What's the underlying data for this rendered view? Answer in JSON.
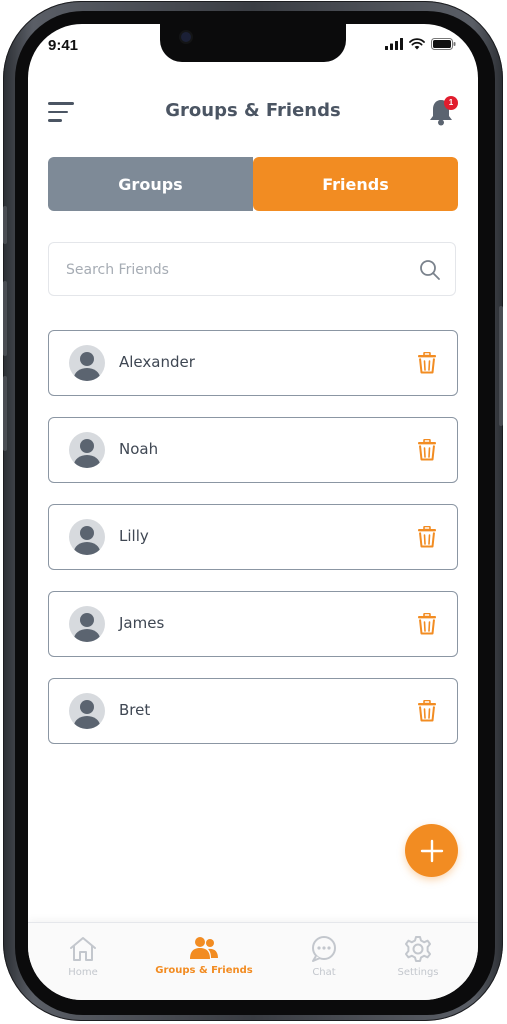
{
  "status_bar": {
    "time": "9:41"
  },
  "header": {
    "title": "Groups & Friends",
    "notification_count": "1"
  },
  "segments": {
    "groups_label": "Groups",
    "friends_label": "Friends",
    "active": "Friends"
  },
  "search": {
    "placeholder": "Search Friends",
    "value": ""
  },
  "friends": [
    {
      "name": "Alexander"
    },
    {
      "name": "Noah"
    },
    {
      "name": "Lilly"
    },
    {
      "name": "James"
    },
    {
      "name": "Bret"
    }
  ],
  "tabbar": {
    "items": [
      {
        "label": "Home",
        "icon": "home-icon"
      },
      {
        "label": "Groups & Friends",
        "icon": "people-icon"
      },
      {
        "label": "Chat",
        "icon": "chat-icon"
      },
      {
        "label": "Settings",
        "icon": "gear-icon"
      }
    ],
    "active": "Groups & Friends"
  },
  "colors": {
    "accent": "#f28c22",
    "inactive_tab": "#7e8a97",
    "text_dark": "#4b5563",
    "badge": "#e11d2e"
  }
}
